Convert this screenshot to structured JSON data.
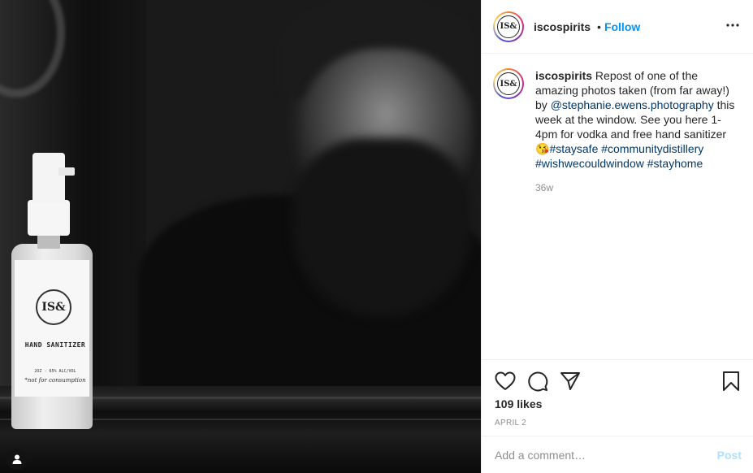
{
  "photo": {
    "bottle_logo": "IS&",
    "bottle_label": "HAND SANITIZER",
    "bottle_sub": "2OZ - 65% ALC/VOL",
    "bottle_note": "*not for consumption",
    "user_tag_icon": "person-icon"
  },
  "header": {
    "avatar_text": "IS&",
    "username": "iscospirits",
    "separator": "•",
    "follow_label": "Follow",
    "more_icon": "more-options-icon"
  },
  "caption": {
    "username": "iscospirits",
    "text_1": " Repost of one of the amazing photos taken (from far away!) by ",
    "mention": "@stephanie.ewens.photography",
    "text_2": " this week at the window. See you here 1-4pm for vodka and free hand sanitizer ",
    "emoji": "😘",
    "hashtags": [
      "#staysafe",
      "#communitydistillery",
      "#wishwecouldwindow",
      "#stayhome"
    ],
    "time": "36w"
  },
  "actions": {
    "like_icon": "heart-icon",
    "comment_icon": "comment-icon",
    "share_icon": "share-icon",
    "save_icon": "bookmark-icon",
    "likes": "109 likes",
    "date": "APRIL 2"
  },
  "comment_box": {
    "placeholder": "Add a comment…",
    "post_label": "Post"
  },
  "colors": {
    "link": "#0095f6",
    "tag": "#00376b",
    "muted": "#8e8e8e",
    "post_disabled": "#b2dffc"
  }
}
